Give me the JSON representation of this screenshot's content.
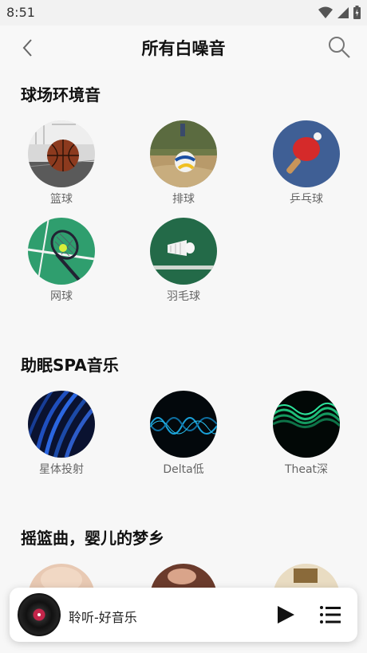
{
  "status_bar": {
    "time": "8:51"
  },
  "app_bar": {
    "title": "所有白噪音"
  },
  "sections": [
    {
      "title": "球场环境音",
      "items": [
        {
          "label": "篮球",
          "icon": "basketball-image"
        },
        {
          "label": "排球",
          "icon": "volleyball-image"
        },
        {
          "label": "乒乓球",
          "icon": "ping-pong-image"
        },
        {
          "label": "网球",
          "icon": "tennis-image"
        },
        {
          "label": "羽毛球",
          "icon": "badminton-image"
        }
      ]
    },
    {
      "title": "助眠SPA音乐",
      "items": [
        {
          "label": "星体投射",
          "icon": "blue-waves-image"
        },
        {
          "label": "Delta低",
          "icon": "blue-soundwave-image"
        },
        {
          "label": "Theat深",
          "icon": "green-waves-image"
        }
      ]
    },
    {
      "title": "摇篮曲，婴儿的梦乡",
      "items": [
        {
          "label": "",
          "icon": "baby-image"
        },
        {
          "label": "",
          "icon": "baby-hands-image"
        },
        {
          "label": "",
          "icon": "music-box-image"
        }
      ]
    }
  ],
  "player": {
    "track_name": "聆听-好音乐"
  },
  "colors": {
    "tennis_green": "#2f9e6e",
    "pingpong_blue": "#3f5f95",
    "accent_red": "#c4254a"
  }
}
